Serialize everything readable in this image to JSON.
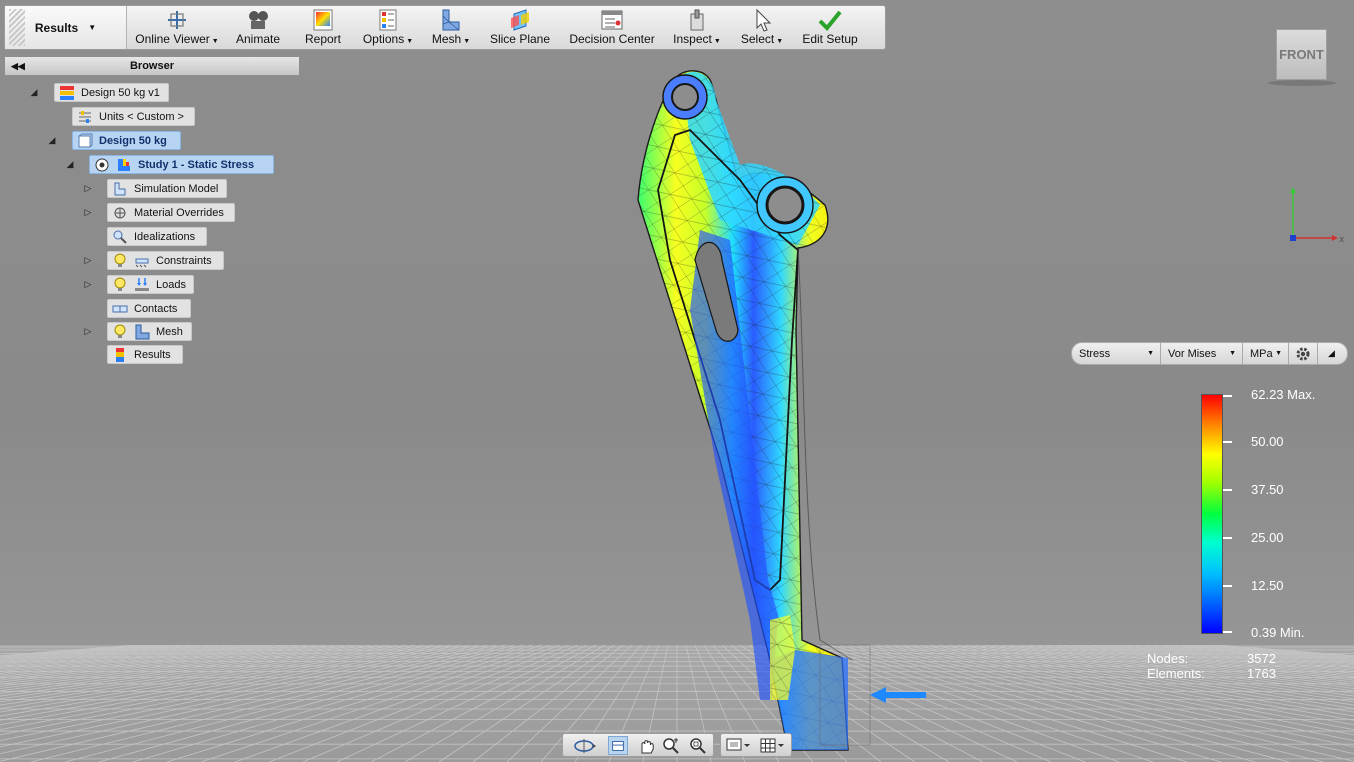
{
  "ribbon": {
    "tab_label": "Results",
    "buttons": [
      {
        "label": "Online Viewer",
        "dropdown": true,
        "icon": "online-viewer-icon"
      },
      {
        "label": "Animate",
        "dropdown": false,
        "icon": "animate-icon"
      },
      {
        "label": "Report",
        "dropdown": false,
        "icon": "report-icon"
      },
      {
        "label": "Options",
        "dropdown": true,
        "icon": "options-icon"
      },
      {
        "label": "Mesh",
        "dropdown": true,
        "icon": "mesh-icon"
      },
      {
        "label": "Slice Plane",
        "dropdown": false,
        "icon": "slice-plane-icon"
      },
      {
        "label": "Decision Center",
        "dropdown": false,
        "icon": "decision-center-icon"
      },
      {
        "label": "Inspect",
        "dropdown": true,
        "icon": "inspect-icon"
      },
      {
        "label": "Select",
        "dropdown": true,
        "icon": "select-cursor-icon"
      },
      {
        "label": "Edit Setup",
        "dropdown": false,
        "icon": "checkmark-icon"
      }
    ]
  },
  "browser": {
    "title": "Browser",
    "nodes": [
      {
        "label": "Design 50 kg v1",
        "icon": "design-icon",
        "selected": false
      },
      {
        "label": "Units < Custom >",
        "icon": "units-icon",
        "selected": false
      },
      {
        "label": "Design 50 kg",
        "icon": "part-icon",
        "selected": true
      },
      {
        "label": "Study 1 - Static Stress",
        "icon": "study-icon",
        "selected": true
      },
      {
        "label": "Simulation Model",
        "icon": "simulation-model-icon",
        "selected": false
      },
      {
        "label": "Material Overrides",
        "icon": "material-icon",
        "selected": false
      },
      {
        "label": "Idealizations",
        "icon": "idealization-icon",
        "selected": false
      },
      {
        "label": "Constraints",
        "icon": "constraint-icon",
        "selected": false
      },
      {
        "label": "Loads",
        "icon": "load-icon",
        "selected": false
      },
      {
        "label": "Contacts",
        "icon": "contact-icon",
        "selected": false
      },
      {
        "label": "Mesh",
        "icon": "mesh-icon",
        "selected": false
      },
      {
        "label": "Results",
        "icon": "results-icon",
        "selected": false
      }
    ]
  },
  "viewcube": {
    "face": "FRONT"
  },
  "result_selectors": {
    "type": "Stress",
    "component": "Vor Mises",
    "unit": "MPa"
  },
  "legend": {
    "max_label": "62.23 Max.",
    "labels": [
      "50.00",
      "37.50",
      "25.00",
      "12.50"
    ],
    "min_label": "0.39 Min.",
    "colors": {
      "max": "#ff0000",
      "min": "#0000ff"
    }
  },
  "stats": {
    "nodes_label": "Nodes:",
    "nodes_value": "3572",
    "elements_label": "Elements:",
    "elements_value": "1763"
  },
  "colors": {
    "background": "#8e8e8e",
    "selection": "#b7d5f3",
    "load_arrow": "#1e88ff"
  }
}
